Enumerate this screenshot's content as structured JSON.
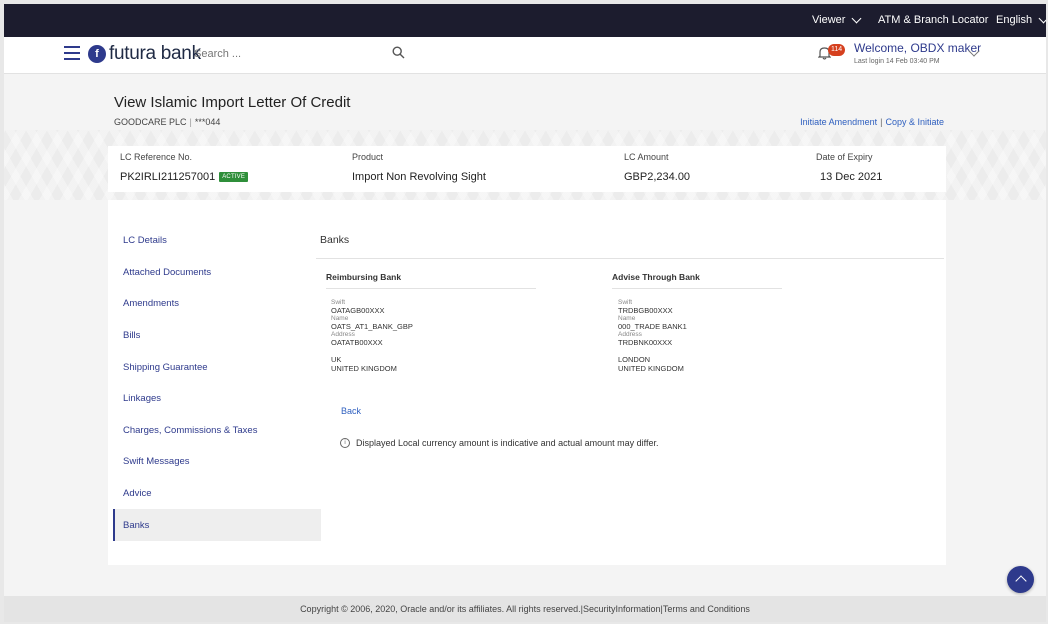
{
  "topbar": {
    "viewer_label": "Viewer",
    "atm_label": "ATM & Branch Locator",
    "language_label": "English"
  },
  "header": {
    "logo_mark": "f",
    "logo_text": "futura bank",
    "search_placeholder": "Search ...",
    "notification_count": "114",
    "welcome": "Welcome, OBDX maker",
    "last_login": "Last login 14 Feb 03:40 PM"
  },
  "page": {
    "title": "View Islamic Import Letter Of Credit",
    "party_name": "GOODCARE PLC",
    "party_account": "***044",
    "initiate_amendment": "Initiate Amendment",
    "copy_initiate": "Copy & Initiate"
  },
  "summary": {
    "lc_ref_label": "LC Reference No.",
    "lc_ref_value": "PK2IRLI211257001",
    "status_badge": "ACTIVE",
    "product_label": "Product",
    "product_value": "Import Non Revolving Sight",
    "amount_label": "LC Amount",
    "amount_value": "GBP2,234.00",
    "expiry_label": "Date of Expiry",
    "expiry_value": "13 Dec 2021"
  },
  "nav": {
    "items": [
      {
        "label": "LC Details"
      },
      {
        "label": "Attached Documents"
      },
      {
        "label": "Amendments"
      },
      {
        "label": "Bills"
      },
      {
        "label": "Shipping Guarantee"
      },
      {
        "label": "Linkages"
      },
      {
        "label": "Charges, Commissions & Taxes"
      },
      {
        "label": "Swift Messages"
      },
      {
        "label": "Advice"
      },
      {
        "label": "Banks"
      }
    ]
  },
  "banks": {
    "title": "Banks",
    "reimbursing": {
      "heading": "Reimbursing Bank",
      "swift_label": "Swift",
      "swift": "OATAGB00XXX",
      "name_label": "Name",
      "name": "OATS_AT1_BANK_GBP",
      "address_label": "Address",
      "address": "OATATB00XXX",
      "city": "UK",
      "country": "UNITED KINGDOM"
    },
    "advise_through": {
      "heading": "Advise Through Bank",
      "swift_label": "Swift",
      "swift": "TRDBGB00XXX",
      "name_label": "Name",
      "name": "000_TRADE BANK1",
      "address_label": "Address",
      "address": "TRDBNK00XXX",
      "city": "LONDON",
      "country": "UNITED KINGDOM"
    },
    "back_label": "Back",
    "info_text": "Displayed Local currency amount is indicative and actual amount may differ."
  },
  "footer": {
    "text": "Copyright © 2006, 2020, Oracle and/or its affiliates. All rights reserved.|SecurityInformation|Terms and Conditions"
  }
}
